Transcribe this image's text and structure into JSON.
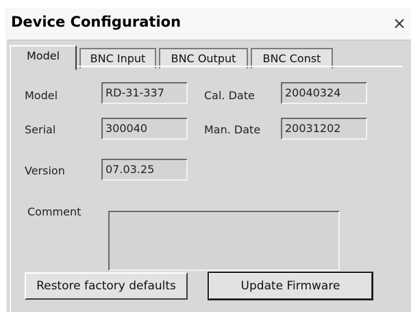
{
  "window": {
    "title": "Device Configuration",
    "close_glyph": "×"
  },
  "tabs": [
    {
      "label": "Model",
      "active": true
    },
    {
      "label": "BNC Input",
      "active": false
    },
    {
      "label": "BNC Output",
      "active": false
    },
    {
      "label": "BNC Const",
      "active": false
    }
  ],
  "fields": {
    "model": {
      "label": "Model",
      "value": "RD-31-337"
    },
    "serial": {
      "label": "Serial",
      "value": "300040"
    },
    "version": {
      "label": "Version",
      "value": "07.03.25"
    },
    "cal_date": {
      "label": "Cal. Date",
      "value": "20040324"
    },
    "man_date": {
      "label": "Man. Date",
      "value": "20031202"
    },
    "comment": {
      "label": "Comment",
      "value": ""
    }
  },
  "buttons": {
    "restore": "Restore factory defaults",
    "update": "Update Firmware"
  },
  "icons": {
    "close": "close-icon"
  },
  "colors": {
    "window_bg": "#d8d8d8",
    "titlebar_bg": "#f7f7f7",
    "field_bg": "#d4d4d4"
  }
}
